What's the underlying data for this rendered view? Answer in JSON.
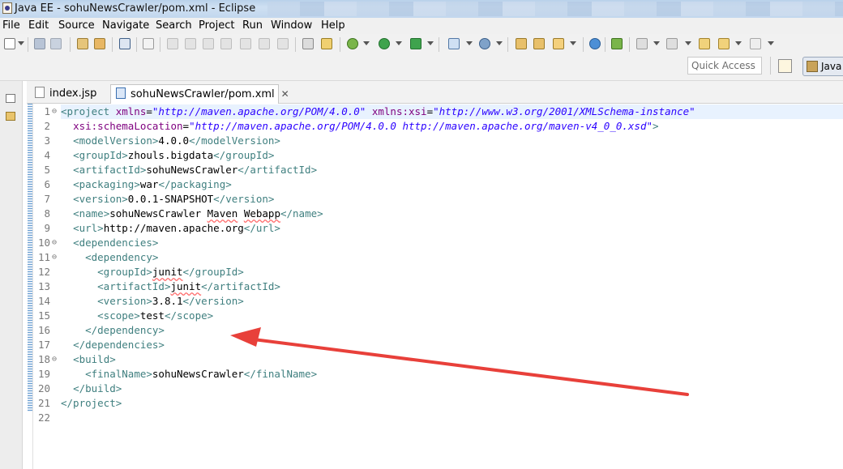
{
  "window": {
    "title": "Java EE - sohuNewsCrawler/pom.xml - Eclipse"
  },
  "menu": [
    "File",
    "Edit",
    "Source",
    "Navigate",
    "Search",
    "Project",
    "Run",
    "Window",
    "Help"
  ],
  "toolbar": {
    "quick_access_placeholder": "Quick Access",
    "perspective_label": "Java"
  },
  "tabs": [
    {
      "label": "index.jsp",
      "active": false
    },
    {
      "label": "sohuNewsCrawler/pom.xml",
      "active": true
    }
  ],
  "editor": {
    "lines": [
      {
        "n": "1",
        "fold": "⊖",
        "tokens": [
          {
            "c": "t-tag",
            "t": "<project "
          },
          {
            "c": "t-attr",
            "t": "xmlns"
          },
          {
            "c": "t-txt",
            "t": "="
          },
          {
            "c": "t-str",
            "t": "\"http://maven.apache.org/POM/4.0.0\""
          },
          {
            "c": "t-txt",
            "t": " "
          },
          {
            "c": "t-attr",
            "t": "xmlns:xsi"
          },
          {
            "c": "t-txt",
            "t": "="
          },
          {
            "c": "t-str",
            "t": "\"http://www.w3.org/2001/XMLSchema-instance\""
          }
        ]
      },
      {
        "n": "2",
        "fold": "",
        "tokens": [
          {
            "c": "t-txt",
            "t": "  "
          },
          {
            "c": "t-attr",
            "t": "xsi:schemaLocation"
          },
          {
            "c": "t-txt",
            "t": "="
          },
          {
            "c": "t-str",
            "t": "\"http://maven.apache.org/POM/4.0.0 http://maven.apache.org/maven-v4_0_0.xsd\""
          },
          {
            "c": "t-tag",
            "t": ">"
          }
        ]
      },
      {
        "n": "3",
        "fold": "",
        "tokens": [
          {
            "c": "t-txt",
            "t": "  "
          },
          {
            "c": "t-tag",
            "t": "<modelVersion>"
          },
          {
            "c": "t-txt",
            "t": "4.0.0"
          },
          {
            "c": "t-tag",
            "t": "</modelVersion>"
          }
        ]
      },
      {
        "n": "4",
        "fold": "",
        "tokens": [
          {
            "c": "t-txt",
            "t": "  "
          },
          {
            "c": "t-tag",
            "t": "<groupId>"
          },
          {
            "c": "t-txt",
            "t": "zhouls.bigdata"
          },
          {
            "c": "t-tag",
            "t": "</groupId>"
          }
        ]
      },
      {
        "n": "5",
        "fold": "",
        "tokens": [
          {
            "c": "t-txt",
            "t": "  "
          },
          {
            "c": "t-tag",
            "t": "<artifactId>"
          },
          {
            "c": "t-txt",
            "t": "sohuNewsCrawler"
          },
          {
            "c": "t-tag",
            "t": "</artifactId>"
          }
        ]
      },
      {
        "n": "6",
        "fold": "",
        "tokens": [
          {
            "c": "t-txt",
            "t": "  "
          },
          {
            "c": "t-tag",
            "t": "<packaging>"
          },
          {
            "c": "t-txt",
            "t": "war"
          },
          {
            "c": "t-tag",
            "t": "</packaging>"
          }
        ]
      },
      {
        "n": "7",
        "fold": "",
        "tokens": [
          {
            "c": "t-txt",
            "t": "  "
          },
          {
            "c": "t-tag",
            "t": "<version>"
          },
          {
            "c": "t-txt",
            "t": "0.0.1-SNAPSHOT"
          },
          {
            "c": "t-tag",
            "t": "</version>"
          }
        ]
      },
      {
        "n": "8",
        "fold": "",
        "tokens": [
          {
            "c": "t-txt",
            "t": "  "
          },
          {
            "c": "t-tag",
            "t": "<name>"
          },
          {
            "c": "t-txt",
            "t": "sohuNewsCrawler "
          },
          {
            "c": "t-txt squiggle",
            "t": "Maven"
          },
          {
            "c": "t-txt",
            "t": " "
          },
          {
            "c": "t-txt squiggle",
            "t": "Webapp"
          },
          {
            "c": "t-tag",
            "t": "</name>"
          }
        ]
      },
      {
        "n": "9",
        "fold": "",
        "tokens": [
          {
            "c": "t-txt",
            "t": "  "
          },
          {
            "c": "t-tag",
            "t": "<url>"
          },
          {
            "c": "t-txt",
            "t": "http://maven.apache.org"
          },
          {
            "c": "t-tag",
            "t": "</url>"
          }
        ]
      },
      {
        "n": "10",
        "fold": "⊖",
        "tokens": [
          {
            "c": "t-txt",
            "t": "  "
          },
          {
            "c": "t-tag",
            "t": "<dependencies>"
          }
        ]
      },
      {
        "n": "11",
        "fold": "⊖",
        "tokens": [
          {
            "c": "t-txt",
            "t": "    "
          },
          {
            "c": "t-tag",
            "t": "<dependency>"
          }
        ]
      },
      {
        "n": "12",
        "fold": "",
        "tokens": [
          {
            "c": "t-txt",
            "t": "      "
          },
          {
            "c": "t-tag",
            "t": "<groupId>"
          },
          {
            "c": "t-txt squiggle",
            "t": "junit"
          },
          {
            "c": "t-tag",
            "t": "</groupId>"
          }
        ]
      },
      {
        "n": "13",
        "fold": "",
        "tokens": [
          {
            "c": "t-txt",
            "t": "      "
          },
          {
            "c": "t-tag",
            "t": "<artifactId>"
          },
          {
            "c": "t-txt squiggle",
            "t": "junit"
          },
          {
            "c": "t-tag",
            "t": "</artifactId>"
          }
        ]
      },
      {
        "n": "14",
        "fold": "",
        "tokens": [
          {
            "c": "t-txt",
            "t": "      "
          },
          {
            "c": "t-tag",
            "t": "<version>"
          },
          {
            "c": "t-txt",
            "t": "3.8.1"
          },
          {
            "c": "t-tag",
            "t": "</version>"
          }
        ]
      },
      {
        "n": "15",
        "fold": "",
        "tokens": [
          {
            "c": "t-txt",
            "t": "      "
          },
          {
            "c": "t-tag",
            "t": "<scope>"
          },
          {
            "c": "t-txt",
            "t": "test"
          },
          {
            "c": "t-tag",
            "t": "</scope>"
          }
        ]
      },
      {
        "n": "16",
        "fold": "",
        "tokens": [
          {
            "c": "t-txt",
            "t": "    "
          },
          {
            "c": "t-tag",
            "t": "</dependency>"
          }
        ]
      },
      {
        "n": "17",
        "fold": "",
        "tokens": [
          {
            "c": "t-txt",
            "t": "  "
          },
          {
            "c": "t-tag",
            "t": "</dependencies>"
          }
        ]
      },
      {
        "n": "18",
        "fold": "⊖",
        "tokens": [
          {
            "c": "t-txt",
            "t": "  "
          },
          {
            "c": "t-tag",
            "t": "<build>"
          }
        ]
      },
      {
        "n": "19",
        "fold": "",
        "tokens": [
          {
            "c": "t-txt",
            "t": "    "
          },
          {
            "c": "t-tag",
            "t": "<finalName>"
          },
          {
            "c": "t-txt",
            "t": "sohuNewsCrawler"
          },
          {
            "c": "t-tag",
            "t": "</finalName>"
          }
        ]
      },
      {
        "n": "20",
        "fold": "",
        "tokens": [
          {
            "c": "t-txt",
            "t": "  "
          },
          {
            "c": "t-tag",
            "t": "</build>"
          }
        ]
      },
      {
        "n": "21",
        "fold": "",
        "tokens": [
          {
            "c": "t-tag",
            "t": "</project>"
          }
        ]
      },
      {
        "n": "22",
        "fold": "",
        "tokens": []
      }
    ]
  },
  "colors": {
    "annotation_arrow": "#e8403a",
    "xml_tag": "#3f7f7f",
    "xml_attr": "#7f007f",
    "xml_string": "#2a00ff"
  }
}
